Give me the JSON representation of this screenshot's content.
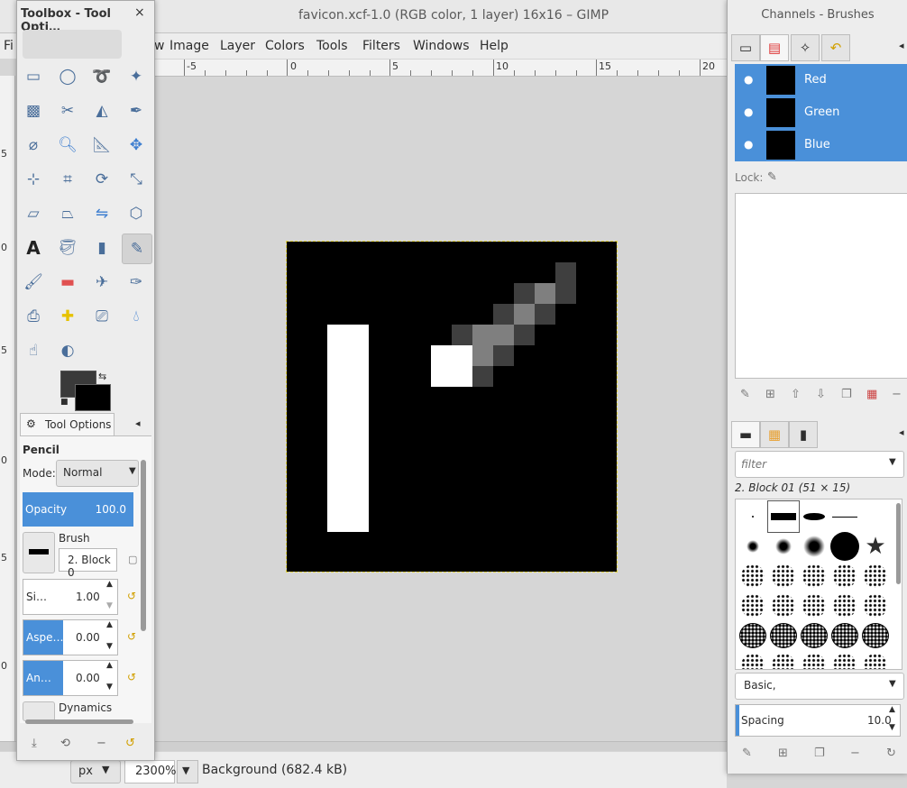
{
  "window": {
    "title": "favicon.xcf-1.0 (RGB color, 1 layer) 16x16 – GIMP"
  },
  "menubar": {
    "items": [
      "Fi",
      "w",
      "Image",
      "Layer",
      "Colors",
      "Tools",
      "Filters",
      "Windows",
      "Help"
    ]
  },
  "hruler": {
    "labels": [
      "-5",
      "0",
      "5",
      "10",
      "15",
      "20"
    ]
  },
  "vruler": {
    "labels": [
      "5",
      "0",
      "5",
      "0",
      "5",
      "0"
    ]
  },
  "statusbar": {
    "unit": "px",
    "zoom": "2300%",
    "message": "Background (682.4 kB)"
  },
  "toolbox": {
    "title": "Toolbox - Tool Opti…",
    "close": "×",
    "tool_icons": [
      "rect-select-icon",
      "ellipse-select-icon",
      "lasso-icon",
      "fuzzy-select-icon",
      "select-by-color-icon",
      "scissors-icon",
      "foreground-select-icon",
      "paths-icon",
      "color-picker-icon",
      "zoom-icon",
      "measure-icon",
      "move-icon",
      "align-icon",
      "crop-icon",
      "rotate-icon",
      "scale-icon",
      "shear-icon",
      "perspective-icon",
      "flip-icon",
      "cage-transform-icon",
      "text-icon",
      "bucket-fill-icon",
      "blend-icon",
      "pencil-icon",
      "paintbrush-icon",
      "eraser-icon",
      "airbrush-icon",
      "ink-icon",
      "clone-icon",
      "heal-icon",
      "perspective-clone-icon",
      "blur-icon",
      "smudge-icon",
      "dodge-burn-icon"
    ],
    "tab_label": "Tool Options",
    "tool_name": "Pencil",
    "mode_label": "Mode:",
    "mode_value": "Normal",
    "opacity_label": "Opacity",
    "opacity_value": "100.0",
    "brush_label": "Brush",
    "brush_value": "2. Block 0",
    "size_label": "Si…",
    "size_value": "1.00",
    "aspect_label": "Aspe…",
    "aspect_value": "0.00",
    "angle_label": "An…",
    "angle_value": "0.00",
    "dynamics_label": "Dynamics"
  },
  "dock": {
    "title": "Channels - Brushes",
    "channels": [
      "Red",
      "Green",
      "Blue"
    ],
    "lock_label": "Lock:",
    "brush_filter_placeholder": "filter",
    "brush_selected": "2. Block 01 (51 × 15)",
    "brush_tag": "Basic,",
    "spacing_label": "Spacing",
    "spacing_value": "10.0"
  },
  "colors": {
    "accent": "#4a90d9",
    "canvas_bg": "#000000"
  }
}
